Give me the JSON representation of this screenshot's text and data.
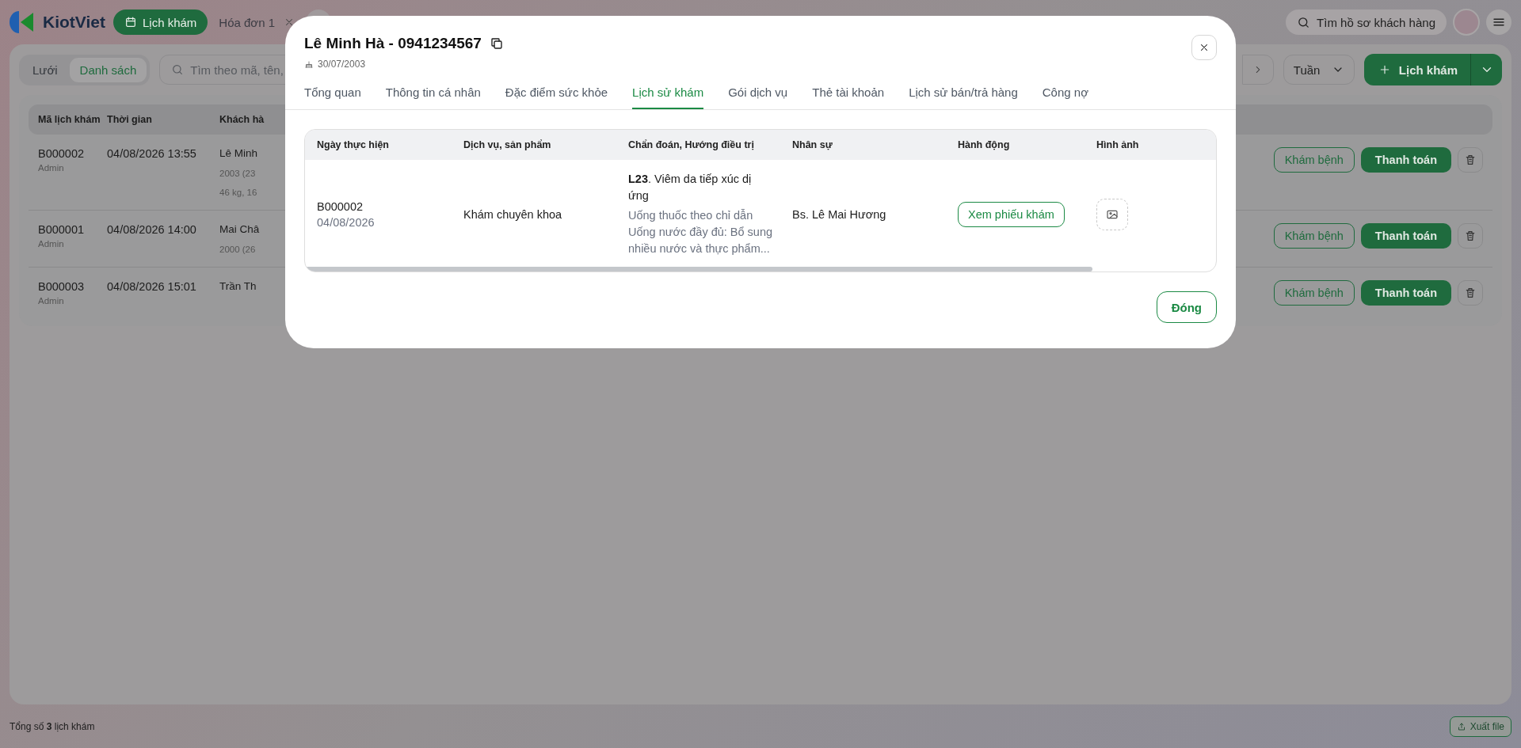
{
  "app": {
    "logo": "KiotViet"
  },
  "tabs": [
    {
      "label": "Lịch khám",
      "selected": true,
      "closable": false
    },
    {
      "label": "Hóa đơn 1",
      "selected": false,
      "closable": true
    }
  ],
  "header_search": {
    "placeholder": "Tìm hồ sơ khách hàng"
  },
  "view_toggle": [
    {
      "label": "Lưới",
      "selected": false
    },
    {
      "label": "Danh sách",
      "selected": true
    }
  ],
  "search": {
    "placeholder": "Tìm theo mã, tên,"
  },
  "period": {
    "value": "Tuần"
  },
  "add_button": {
    "label": "Lịch khám"
  },
  "table": {
    "columns": [
      "Mã lịch khám",
      "Thời gian",
      "Khách hà"
    ],
    "rows": [
      {
        "code": "B000002",
        "creator": "Admin",
        "time": "04/08/2026 13:55",
        "customer": [
          "Lê Minh",
          "2003 (23",
          "46 kg, 16"
        ],
        "actions": [
          "Khám bệnh",
          "Thanh toán"
        ]
      },
      {
        "code": "B000001",
        "creator": "Admin",
        "time": "04/08/2026 14:00",
        "customer": [
          "Mai Châ",
          "2000 (26"
        ],
        "actions": [
          "Khám bệnh",
          "Thanh toán"
        ]
      },
      {
        "code": "B000003",
        "creator": "Admin",
        "time": "04/08/2026 15:01",
        "customer": [
          "Trần Th"
        ],
        "actions": [
          "Khám bệnh",
          "Thanh toán"
        ]
      }
    ]
  },
  "footer": {
    "summary": "Tổng số **3** lịch khám",
    "export": "Xuất file"
  },
  "modal": {
    "title": "Lê Minh Hà - 0941234567",
    "birthday": "30/07/2003",
    "tabs": [
      {
        "label": "Tổng quan",
        "selected": false
      },
      {
        "label": "Thông tin cá nhân",
        "selected": false
      },
      {
        "label": "Đặc điểm sức khỏe",
        "selected": false
      },
      {
        "label": "Lịch sử khám",
        "selected": true
      },
      {
        "label": "Gói dịch vụ",
        "selected": false
      },
      {
        "label": "Thẻ tài khoản",
        "selected": false
      },
      {
        "label": "Lịch sử bán/trả hàng",
        "selected": false
      },
      {
        "label": "Công nợ",
        "selected": false
      }
    ],
    "table": {
      "columns": [
        "Ngày thực hiện",
        "Dịch vụ, sản phẩm",
        "Chẩn đoán, Hướng điều trị",
        "Nhân sự",
        "Hành động",
        "Hình ảnh"
      ],
      "rows": [
        {
          "code": "B000002",
          "date": "04/08/2026",
          "service": "Khám chuyên khoa",
          "diagnosis": "**L23**. Viêm da tiếp xúc dị ứng",
          "treatment": [
            "Uống thuốc theo chỉ dẫn",
            "Uống nước đầy đủ: Bổ sung nhiều nước và thực phẩm..."
          ],
          "staff": "Bs. Lê Mai Hương",
          "action": "Xem phiếu khám"
        }
      ]
    },
    "close_button": "Đóng"
  }
}
